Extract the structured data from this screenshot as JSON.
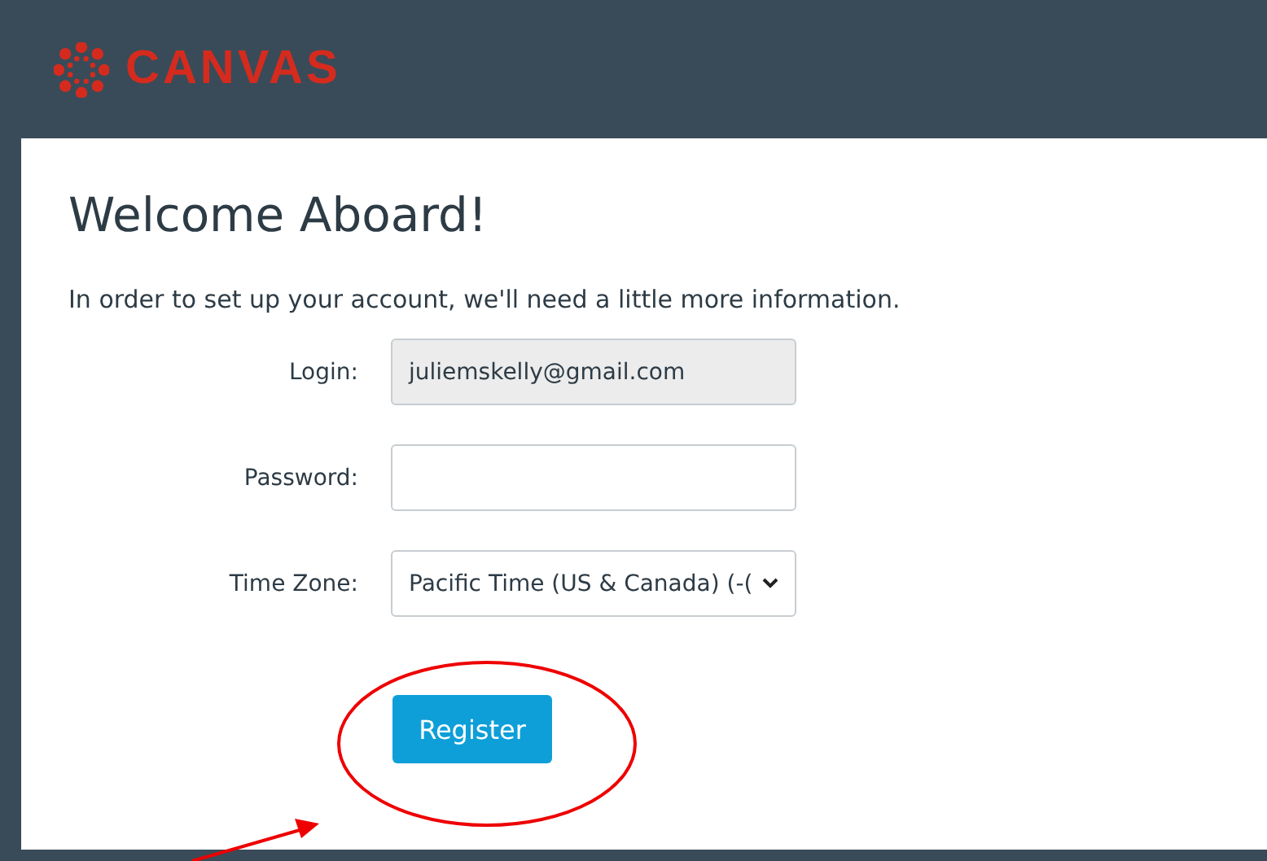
{
  "header": {
    "brand": "CANVAS"
  },
  "heading": "Welcome Aboard!",
  "intro": "In order to set up your account, we'll need a little more information.",
  "fields": [
    {
      "kind": "readonly",
      "label": "Login:",
      "value": "juliemskelly@gmail.com"
    },
    {
      "kind": "password",
      "label": "Password:"
    },
    {
      "kind": "select",
      "label": "Time Zone:",
      "value": "Pacific Time (US & Canada) (-("
    }
  ],
  "button": "Register"
}
